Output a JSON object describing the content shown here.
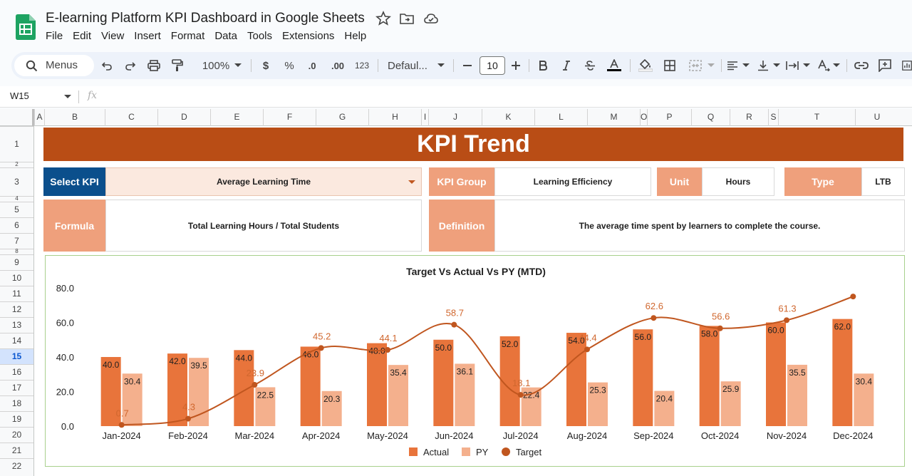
{
  "app": {
    "doc_title": "E-learning Platform KPI Dashboard in Google Sheets",
    "menus": [
      "File",
      "Edit",
      "View",
      "Insert",
      "Format",
      "Data",
      "Tools",
      "Extensions",
      "Help"
    ]
  },
  "toolbar": {
    "search_label": "Menus",
    "zoom": "100%",
    "currency": "$",
    "percent": "%",
    "dec_decrease": ".0",
    "dec_increase": ".00",
    "number_format": "123",
    "font_name": "Defaul...",
    "font_size": "10"
  },
  "formula_bar": {
    "cell_ref": "W15",
    "fx": "fx"
  },
  "grid": {
    "columns": [
      "A",
      "B",
      "C",
      "D",
      "E",
      "F",
      "G",
      "H",
      "I",
      "J",
      "K",
      "L",
      "M",
      "O",
      "P",
      "Q",
      "R",
      "S",
      "T",
      "U"
    ],
    "rows": [
      "1",
      "2",
      "3",
      "4",
      "5",
      "6",
      "7",
      "8",
      "9",
      "10",
      "11",
      "12",
      "13",
      "14",
      "15",
      "16",
      "17",
      "18",
      "19",
      "20",
      "21",
      "22"
    ],
    "selected_row": "15"
  },
  "dashboard": {
    "banner": "KPI Trend",
    "select_kpi_label": "Select KPI",
    "select_kpi_value": "Average Learning Time",
    "kpi_group_label": "KPI Group",
    "kpi_group_value": "Learning Efficiency",
    "unit_label": "Unit",
    "unit_value": "Hours",
    "type_label": "Type",
    "type_value": "LTB",
    "formula_label": "Formula",
    "formula_value": "Total Learning Hours / Total Students",
    "definition_label": "Definition",
    "definition_value": "The average time spent by learners to complete the course."
  },
  "colors": {
    "banner": "#b94d15",
    "actual": "#e8743b",
    "py": "#f4b08d",
    "target": "#c0561f",
    "select_label": "#0b4f8c",
    "orange_label": "#efa07c"
  },
  "chart_data": {
    "type": "bar",
    "title": "Target Vs Actual Vs PY (MTD)",
    "categories": [
      "Jan-2024",
      "Feb-2024",
      "Mar-2024",
      "Apr-2024",
      "May-2024",
      "Jun-2024",
      "Jul-2024",
      "Aug-2024",
      "Sep-2024",
      "Oct-2024",
      "Nov-2024",
      "Dec-2024"
    ],
    "series": [
      {
        "name": "Actual",
        "kind": "bar",
        "values": [
          40.0,
          42.0,
          44.0,
          46.0,
          48.0,
          50.0,
          52.0,
          54.0,
          56.0,
          58.0,
          60.0,
          62.0
        ]
      },
      {
        "name": "PY",
        "kind": "bar",
        "values": [
          30.4,
          39.5,
          22.5,
          20.3,
          35.4,
          36.1,
          22.4,
          25.3,
          20.4,
          25.9,
          35.5,
          30.4
        ]
      },
      {
        "name": "Target",
        "kind": "line",
        "values": [
          0.7,
          4.3,
          23.9,
          45.2,
          44.1,
          58.7,
          18.1,
          44.4,
          62.6,
          56.6,
          61.3,
          75.0
        ]
      }
    ],
    "target_labels": [
      "0.7",
      "4.3",
      "23.9",
      "45.2",
      "44.1",
      "58.7",
      "18.1",
      "44.4",
      "62.6",
      "56.6",
      "61.3",
      ""
    ],
    "y_ticks": [
      "0.0",
      "20.0",
      "40.0",
      "60.0",
      "80.0"
    ],
    "ylim": [
      0,
      80
    ],
    "legend": [
      "Actual",
      "PY",
      "Target"
    ],
    "legend_position": "bottom"
  }
}
